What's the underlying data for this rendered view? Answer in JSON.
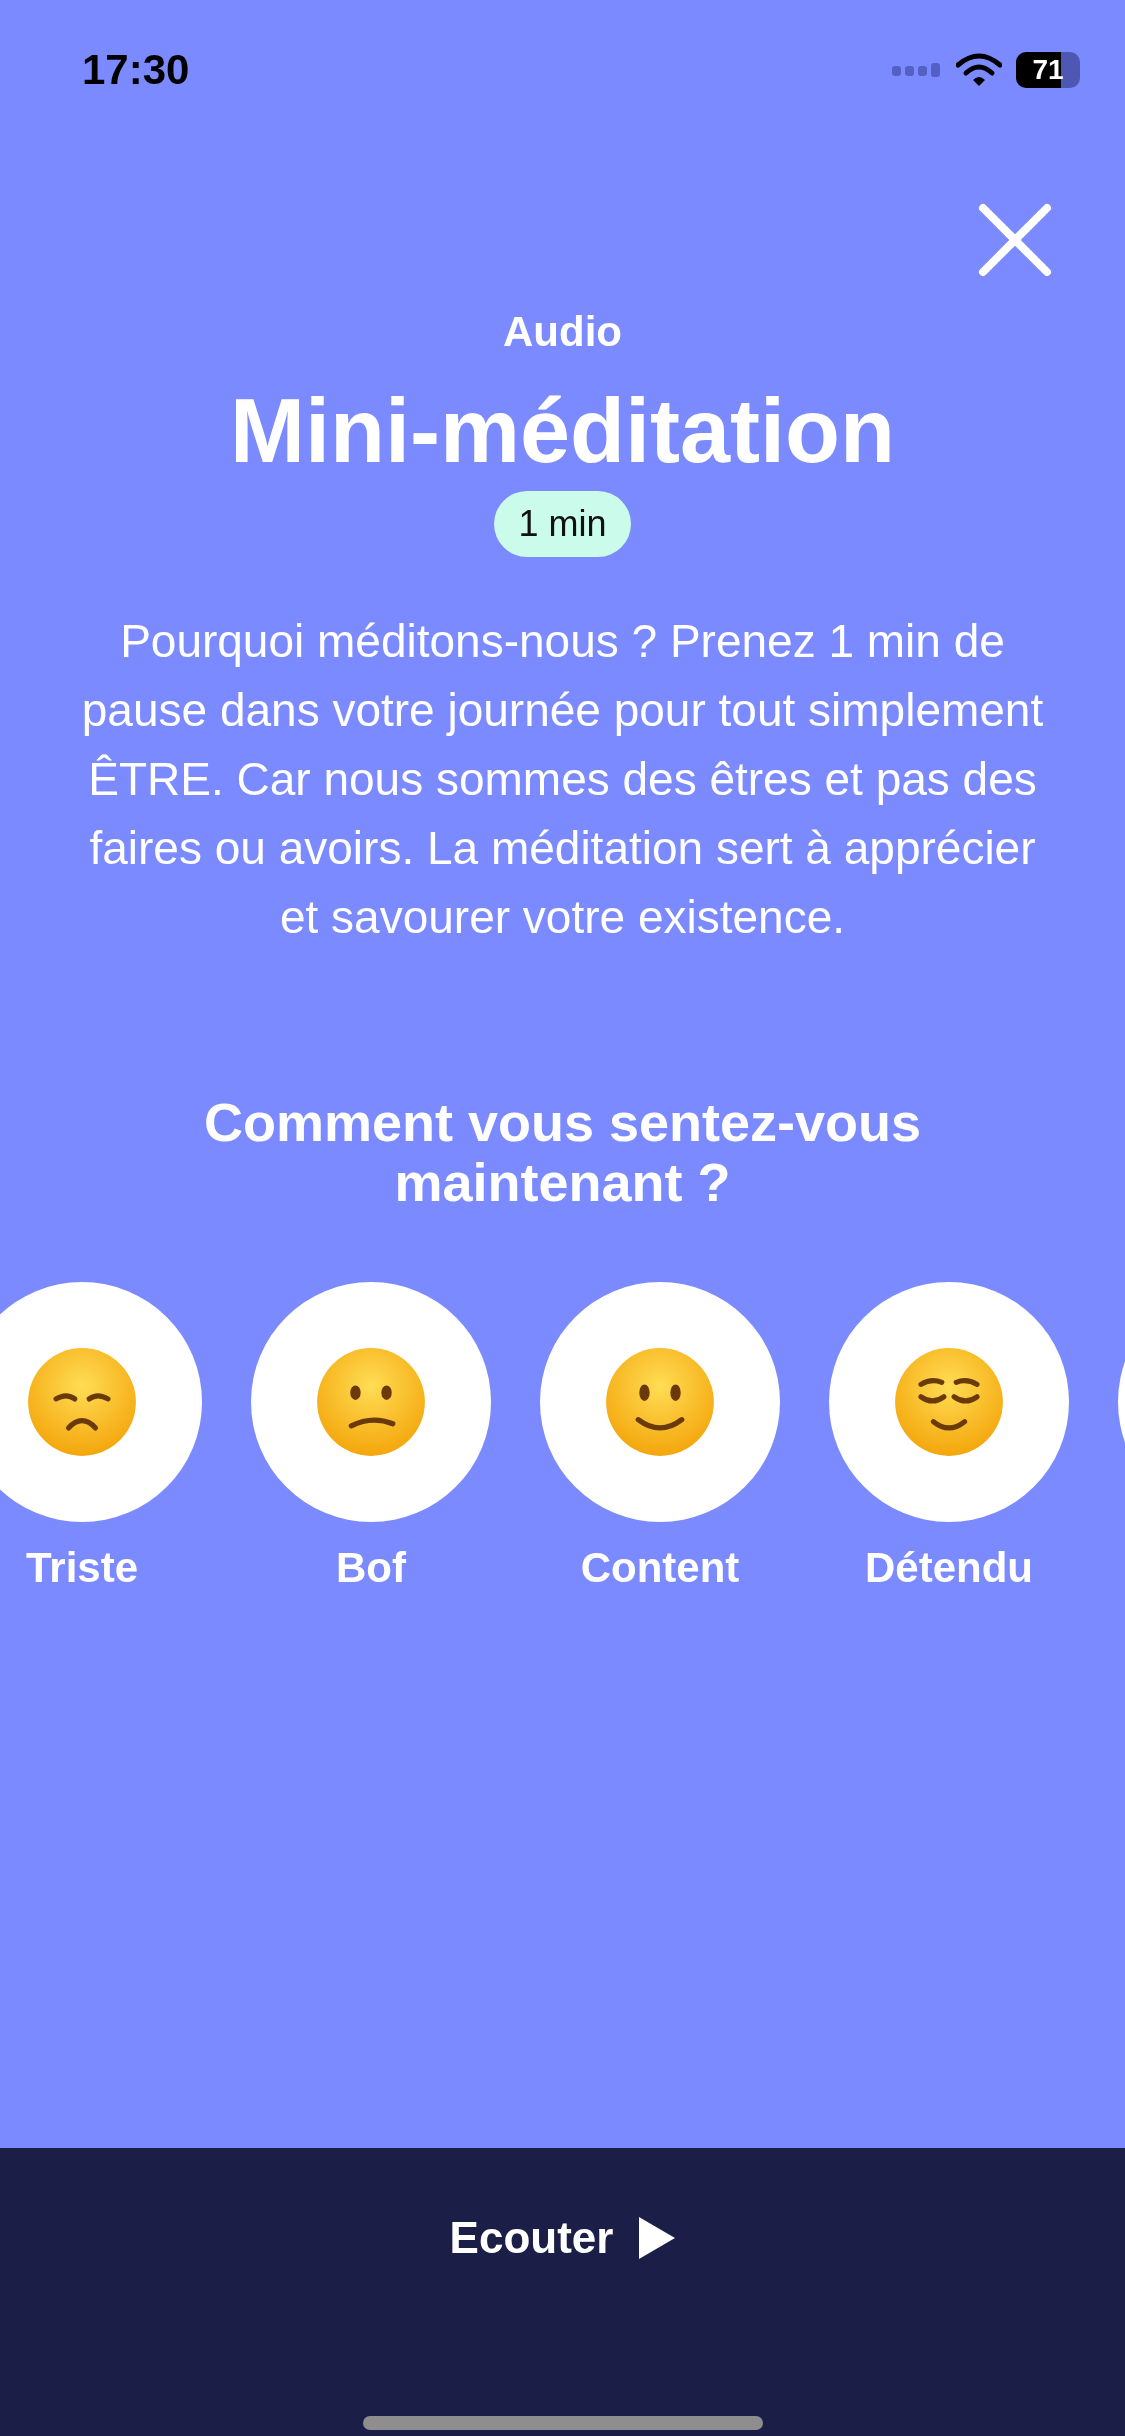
{
  "status_bar": {
    "time": "17:30",
    "battery": "71"
  },
  "header": {
    "category": "Audio",
    "title": "Mini-méditation",
    "duration": "1 min"
  },
  "description": "Pourquoi méditons-nous ? Prenez 1 min de pause dans votre journée pour tout simplement ÊTRE. Car nous sommes des êtres et pas des faires ou avoirs. La méditation sert à apprécier et savourer votre existence.",
  "question": "Comment vous sentez-vous maintenant ?",
  "moods": [
    {
      "kind": "sad",
      "label": "Triste"
    },
    {
      "kind": "meh",
      "label": "Bof"
    },
    {
      "kind": "smile",
      "label": "Content"
    },
    {
      "kind": "relaxed",
      "label": "Détendu"
    },
    {
      "kind": "cut"
    }
  ],
  "footer": {
    "button": "Ecouter"
  }
}
